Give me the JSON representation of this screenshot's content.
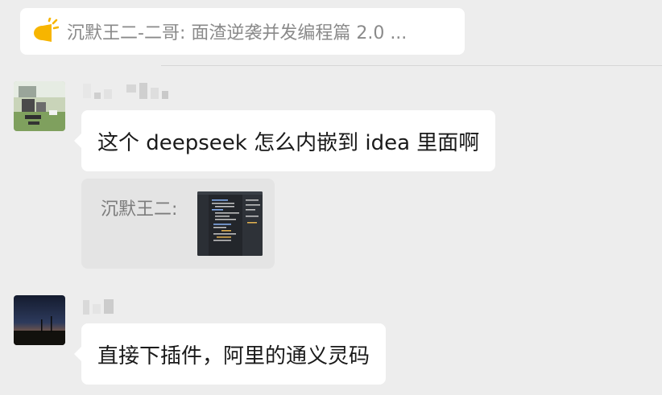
{
  "pinned": {
    "icon": "megaphone-icon",
    "text": "沉默王二-二哥: 面渣逆袭并发编程篇 2.0 ..."
  },
  "messages": [
    {
      "avatar": "landscape-avatar",
      "sender": "",
      "text": "这个 deepseek 怎么内嵌到 idea 里面啊",
      "quote": {
        "label": "沉默王二:",
        "thumbnail": "code-screenshot-thumbnail"
      }
    },
    {
      "avatar": "night-sky-avatar",
      "sender": "",
      "text": "直接下插件，阿里的通义灵码"
    }
  ],
  "colors": {
    "background": "#ededed",
    "bubble": "#ffffff",
    "quote_bg": "#e4e4e4",
    "pin_icon": "#f7b500"
  }
}
